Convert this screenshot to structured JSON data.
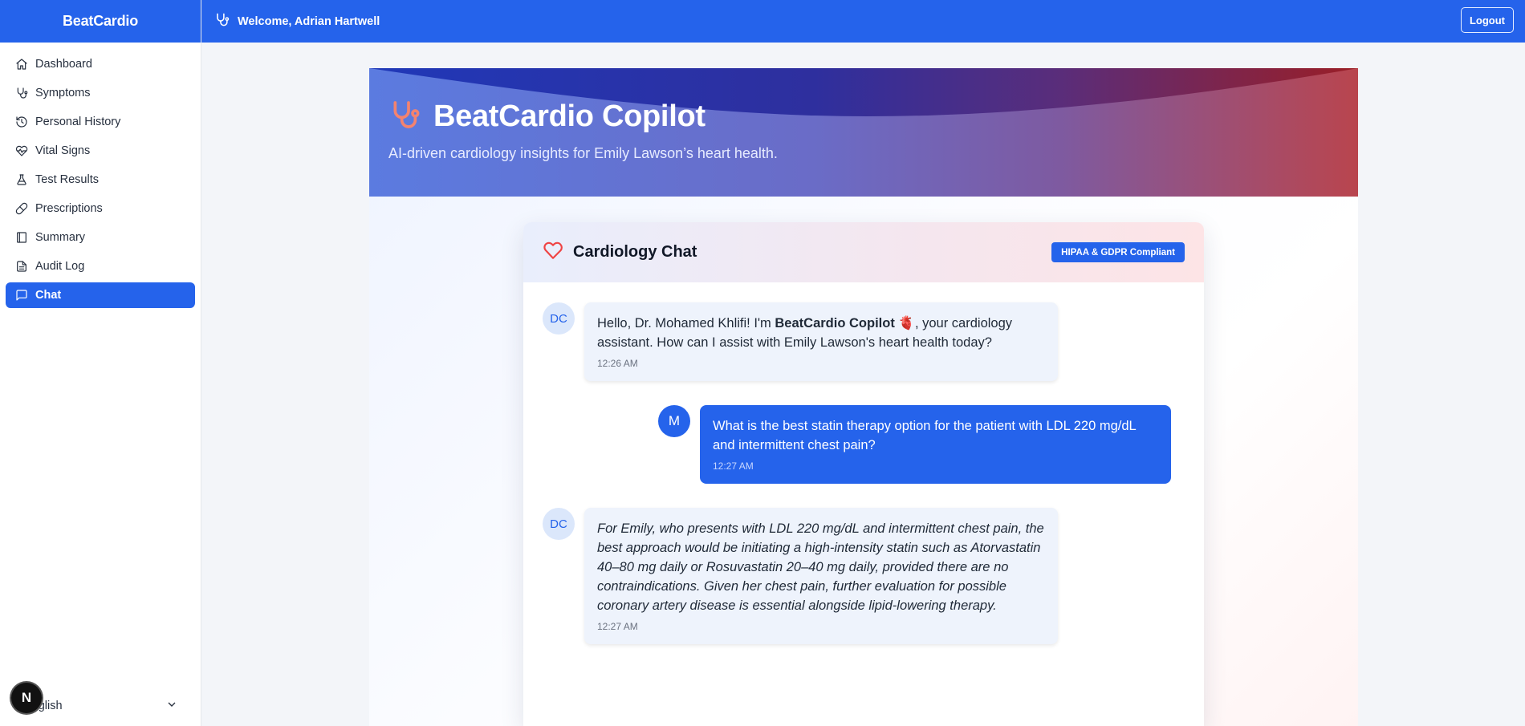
{
  "app": {
    "brand": "BeatCardio"
  },
  "topbar": {
    "welcome": "Welcome, Adrian Hartwell",
    "logout_label": "Logout"
  },
  "sidebar": {
    "items": [
      {
        "label": "Dashboard",
        "icon": "home-icon"
      },
      {
        "label": "Symptoms",
        "icon": "stethoscope-icon"
      },
      {
        "label": "Personal History",
        "icon": "history-icon"
      },
      {
        "label": "Vital Signs",
        "icon": "heart-pulse-icon"
      },
      {
        "label": "Test Results",
        "icon": "flask-icon"
      },
      {
        "label": "Prescriptions",
        "icon": "pill-icon"
      },
      {
        "label": "Summary",
        "icon": "book-icon"
      },
      {
        "label": "Audit Log",
        "icon": "file-text-icon"
      },
      {
        "label": "Chat",
        "icon": "message-icon",
        "active": true
      }
    ],
    "language": "English",
    "n_badge": "N"
  },
  "hero": {
    "title": "BeatCardio Copilot",
    "subtitle": "AI-driven cardiology insights for Emily Lawson’s heart health."
  },
  "chat": {
    "title": "Cardiology Chat",
    "badge": "HIPAA & GDPR Compliant",
    "messages": [
      {
        "sender": "bot",
        "avatar": "DC",
        "text_before": "Hello, Dr. Mohamed Khlifi! I'm ",
        "text_bold": "BeatCardio Copilot",
        "text_emoji": "🫀",
        "text_after": ", your cardiology assistant. How can I assist with Emily Lawson's heart health today?",
        "time": "12:26 AM"
      },
      {
        "sender": "user",
        "avatar": "M",
        "text": "What is the best statin therapy option for the patient with LDL 220 mg/dL and intermittent chest pain?",
        "time": "12:27 AM"
      },
      {
        "sender": "bot",
        "avatar": "DC",
        "text": "For Emily, who presents with LDL 220 mg/dL and intermittent chest pain, the best approach would be initiating a high-intensity statin such as Atorvastatin 40–80 mg daily or Rosuvastatin 20–40 mg daily, provided there are no contraindications. Given her chest pain, further evaluation for possible coronary artery disease is essential alongside lipid-lowering therapy.",
        "time": "12:27 AM"
      }
    ]
  },
  "colors": {
    "primary": "#2563eb",
    "accent_red": "#ef4444",
    "stethoscope": "#f4836f"
  }
}
